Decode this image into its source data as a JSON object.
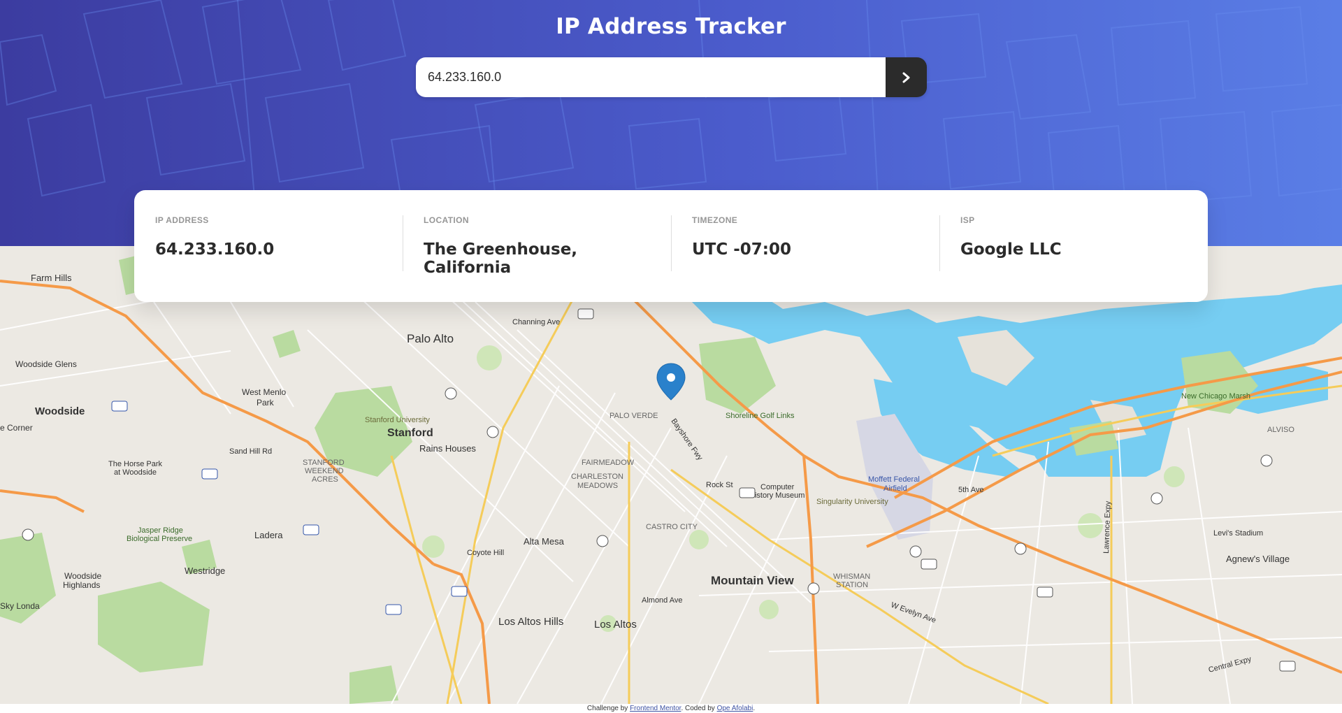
{
  "header": {
    "title": "IP Address Tracker",
    "search_value": "64.233.160.0"
  },
  "info": {
    "ip_label": "IP ADDRESS",
    "ip_value": "64.233.160.0",
    "location_label": "LOCATION",
    "location_value": "The Greenhouse, California",
    "timezone_label": "TIMEZONE",
    "timezone_value": "UTC -07:00",
    "isp_label": "ISP",
    "isp_value": "Google LLC"
  },
  "map": {
    "labels": {
      "farm_hills": "Farm Hills",
      "palo_alto": "Palo Alto",
      "channing": "Channing Ave",
      "woodside_glens": "Woodside Glens",
      "woodside": "Woodside",
      "west_menlo": "West Menlo",
      "park": "Park",
      "stanford_univ": "Stanford University",
      "stanford": "Stanford",
      "rains": "Rains Houses",
      "palo_verde": "PALO VERDE",
      "shoreline": "Shoreline Golf Links",
      "fairmeadow": "FAIRMEADOW",
      "charleston": "CHARLESTON",
      "meadows": "MEADOWS",
      "stanford_weekend": "STANFORD",
      "weekend": "WEEKEND",
      "acres": "ACRES",
      "horse_park": "The Horse Park",
      "at_woodside": "at Woodside",
      "corner": "e Corner",
      "sand_hill": "Sand Hill Rd",
      "computer_museum": "Computer",
      "history_museum": "History Museum",
      "rock_st": "Rock St",
      "moffett": "Moffett Federal",
      "airfield": "Airfield",
      "singularity": "Singularity University",
      "new_chicago": "New Chicago Marsh",
      "alviso": "ALVISO",
      "jasper": "Jasper Ridge",
      "biological": "Biological Preserve",
      "ladera": "Ladera",
      "alta_mesa": "Alta Mesa",
      "coyote": "Coyote Hill",
      "castro": "CASTRO CITY",
      "mountain_view": "Mountain View",
      "whisman": "WHISMAN",
      "station": "STATION",
      "levis": "Levi's Stadium",
      "agnews": "Agnew's Village",
      "westridge": "Westridge",
      "woodside_highlands": "Woodside",
      "highlands": "Highlands",
      "sky_londa": "Sky Londa",
      "los_altos_hills": "Los Altos Hills",
      "los_altos": "Los Altos",
      "almond": "Almond Ave",
      "bayshore": "Bayshore Fwy",
      "lawrence": "Lawrence Expy",
      "central": "Central Expy",
      "evelyn": "W Evelyn Ave",
      "fifth": "5th Ave"
    }
  },
  "footer": {
    "prefix": "Challenge by",
    "link1": "Frontend Mentor",
    "middle": ". Coded by",
    "link2": "Ope Afolabi",
    "suffix": "."
  }
}
